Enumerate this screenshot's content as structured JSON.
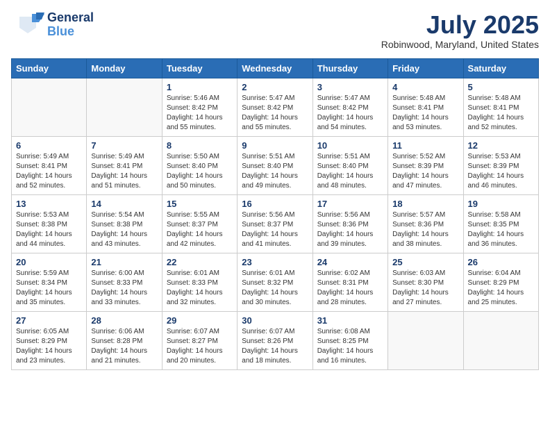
{
  "header": {
    "logo_general": "General",
    "logo_blue": "Blue",
    "month_title": "July 2025",
    "location": "Robinwood, Maryland, United States"
  },
  "days_of_week": [
    "Sunday",
    "Monday",
    "Tuesday",
    "Wednesday",
    "Thursday",
    "Friday",
    "Saturday"
  ],
  "weeks": [
    [
      {
        "day": "",
        "info": ""
      },
      {
        "day": "",
        "info": ""
      },
      {
        "day": "1",
        "info": "Sunrise: 5:46 AM\nSunset: 8:42 PM\nDaylight: 14 hours and 55 minutes."
      },
      {
        "day": "2",
        "info": "Sunrise: 5:47 AM\nSunset: 8:42 PM\nDaylight: 14 hours and 55 minutes."
      },
      {
        "day": "3",
        "info": "Sunrise: 5:47 AM\nSunset: 8:42 PM\nDaylight: 14 hours and 54 minutes."
      },
      {
        "day": "4",
        "info": "Sunrise: 5:48 AM\nSunset: 8:41 PM\nDaylight: 14 hours and 53 minutes."
      },
      {
        "day": "5",
        "info": "Sunrise: 5:48 AM\nSunset: 8:41 PM\nDaylight: 14 hours and 52 minutes."
      }
    ],
    [
      {
        "day": "6",
        "info": "Sunrise: 5:49 AM\nSunset: 8:41 PM\nDaylight: 14 hours and 52 minutes."
      },
      {
        "day": "7",
        "info": "Sunrise: 5:49 AM\nSunset: 8:41 PM\nDaylight: 14 hours and 51 minutes."
      },
      {
        "day": "8",
        "info": "Sunrise: 5:50 AM\nSunset: 8:40 PM\nDaylight: 14 hours and 50 minutes."
      },
      {
        "day": "9",
        "info": "Sunrise: 5:51 AM\nSunset: 8:40 PM\nDaylight: 14 hours and 49 minutes."
      },
      {
        "day": "10",
        "info": "Sunrise: 5:51 AM\nSunset: 8:40 PM\nDaylight: 14 hours and 48 minutes."
      },
      {
        "day": "11",
        "info": "Sunrise: 5:52 AM\nSunset: 8:39 PM\nDaylight: 14 hours and 47 minutes."
      },
      {
        "day": "12",
        "info": "Sunrise: 5:53 AM\nSunset: 8:39 PM\nDaylight: 14 hours and 46 minutes."
      }
    ],
    [
      {
        "day": "13",
        "info": "Sunrise: 5:53 AM\nSunset: 8:38 PM\nDaylight: 14 hours and 44 minutes."
      },
      {
        "day": "14",
        "info": "Sunrise: 5:54 AM\nSunset: 8:38 PM\nDaylight: 14 hours and 43 minutes."
      },
      {
        "day": "15",
        "info": "Sunrise: 5:55 AM\nSunset: 8:37 PM\nDaylight: 14 hours and 42 minutes."
      },
      {
        "day": "16",
        "info": "Sunrise: 5:56 AM\nSunset: 8:37 PM\nDaylight: 14 hours and 41 minutes."
      },
      {
        "day": "17",
        "info": "Sunrise: 5:56 AM\nSunset: 8:36 PM\nDaylight: 14 hours and 39 minutes."
      },
      {
        "day": "18",
        "info": "Sunrise: 5:57 AM\nSunset: 8:36 PM\nDaylight: 14 hours and 38 minutes."
      },
      {
        "day": "19",
        "info": "Sunrise: 5:58 AM\nSunset: 8:35 PM\nDaylight: 14 hours and 36 minutes."
      }
    ],
    [
      {
        "day": "20",
        "info": "Sunrise: 5:59 AM\nSunset: 8:34 PM\nDaylight: 14 hours and 35 minutes."
      },
      {
        "day": "21",
        "info": "Sunrise: 6:00 AM\nSunset: 8:33 PM\nDaylight: 14 hours and 33 minutes."
      },
      {
        "day": "22",
        "info": "Sunrise: 6:01 AM\nSunset: 8:33 PM\nDaylight: 14 hours and 32 minutes."
      },
      {
        "day": "23",
        "info": "Sunrise: 6:01 AM\nSunset: 8:32 PM\nDaylight: 14 hours and 30 minutes."
      },
      {
        "day": "24",
        "info": "Sunrise: 6:02 AM\nSunset: 8:31 PM\nDaylight: 14 hours and 28 minutes."
      },
      {
        "day": "25",
        "info": "Sunrise: 6:03 AM\nSunset: 8:30 PM\nDaylight: 14 hours and 27 minutes."
      },
      {
        "day": "26",
        "info": "Sunrise: 6:04 AM\nSunset: 8:29 PM\nDaylight: 14 hours and 25 minutes."
      }
    ],
    [
      {
        "day": "27",
        "info": "Sunrise: 6:05 AM\nSunset: 8:29 PM\nDaylight: 14 hours and 23 minutes."
      },
      {
        "day": "28",
        "info": "Sunrise: 6:06 AM\nSunset: 8:28 PM\nDaylight: 14 hours and 21 minutes."
      },
      {
        "day": "29",
        "info": "Sunrise: 6:07 AM\nSunset: 8:27 PM\nDaylight: 14 hours and 20 minutes."
      },
      {
        "day": "30",
        "info": "Sunrise: 6:07 AM\nSunset: 8:26 PM\nDaylight: 14 hours and 18 minutes."
      },
      {
        "day": "31",
        "info": "Sunrise: 6:08 AM\nSunset: 8:25 PM\nDaylight: 14 hours and 16 minutes."
      },
      {
        "day": "",
        "info": ""
      },
      {
        "day": "",
        "info": ""
      }
    ]
  ]
}
